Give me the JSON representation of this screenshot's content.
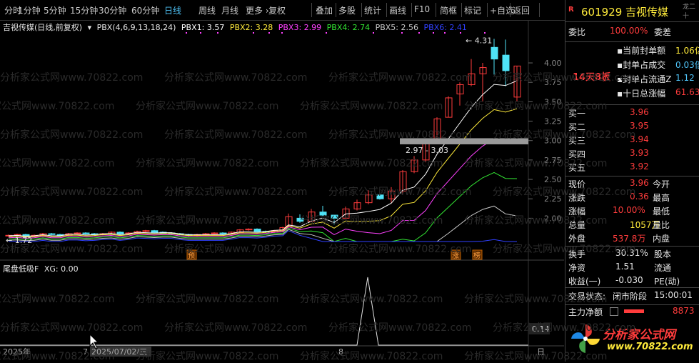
{
  "toolbar": {
    "items": [
      "分时",
      "1分钟",
      "5分钟",
      "15分钟",
      "30分钟",
      "60分钟",
      "日线",
      "周线",
      "月线",
      "更多 ›",
      "复权",
      "叠加",
      "多股",
      "统计",
      "画线",
      "F10",
      "简框",
      "标记",
      "+自选",
      "返回"
    ],
    "active_index": 6
  },
  "indicator_main": {
    "name": "吉视传媒(日线,前复权)",
    "formula": "PBX(4,6,9,13,18,24)",
    "pbx1": "PBX1: 3.57",
    "pbx2": "PBX2: 3.28",
    "pbx3": "PBX3: 2.99",
    "pbx4": "PBX4: 2.74",
    "pbx5": "PBX5: 2.56",
    "pbx6": "PBX6: 2.41"
  },
  "indicator_sub": {
    "name": "尾盘低吸F",
    "value": "XG: 0.00"
  },
  "chart_labels": {
    "high_mark": "4.31",
    "low_mark": "1.72",
    "range_mark": "2.97 - 3.03",
    "tag_yu": "预",
    "tag_zhang": "涨",
    "tag_bang": "榜",
    "sub_value": "0.14",
    "date_left": "2025年",
    "date_cursor": "2025/07/02/三",
    "date_7": "7",
    "date_8": "8",
    "date_right": "日"
  },
  "axis": {
    "ticks": [
      "4.00",
      "3.75",
      "3.50",
      "3.25",
      "3.00",
      "2.75",
      "2.50",
      "2.25",
      "2.00"
    ]
  },
  "chart_data": {
    "type": "candlestick",
    "y_ticks": [
      4.0,
      3.75,
      3.5,
      3.25,
      3.0,
      2.75,
      2.5,
      2.25,
      2.0
    ],
    "ylim": [
      1.7,
      4.35
    ]
  },
  "colors": {
    "up": "#ff3c3c",
    "down": "#4fe3f7",
    "pbx1": "#ffffff",
    "pbx2": "#ffeb3b",
    "pbx3": "#ff40ff",
    "pbx4": "#33e633",
    "pbx5": "#c8c8c8",
    "pbx6": "#3040ff"
  },
  "stock": {
    "code": "601929",
    "name": "吉视传媒",
    "corner": "龙二十"
  },
  "ratio": {
    "label": "委比",
    "value": "100.00%",
    "label2": "委差"
  },
  "board": {
    "streak": "14天8板",
    "items": [
      {
        "label": "当前封单额",
        "value": "1.06亿"
      },
      {
        "label": "封单占成交",
        "value": "0.03倍"
      },
      {
        "label": "封单占流通Z",
        "value": "1.12"
      },
      {
        "label": "十日总涨幅",
        "value": "61.63"
      }
    ]
  },
  "bids": [
    {
      "label": "买一",
      "price": "3.96"
    },
    {
      "label": "买二",
      "price": "3.95"
    },
    {
      "label": "买三",
      "price": "3.94"
    },
    {
      "label": "买四",
      "price": "3.93"
    },
    {
      "label": "买五",
      "price": "3.92"
    }
  ],
  "quote": [
    {
      "l1": "现价",
      "v1": "3.96",
      "l2": "今开"
    },
    {
      "l1": "涨跌",
      "v1": "0.36",
      "l2": "最高"
    },
    {
      "l1": "涨幅",
      "v1": "10.00%",
      "l2": "最低"
    },
    {
      "l1": "总量",
      "v1": "1057万",
      "l2": "量比"
    },
    {
      "l1": "外盘",
      "v1": "537.8万",
      "l2": "内盘"
    }
  ],
  "stats": [
    {
      "l1": "换手",
      "v1": "30.31%",
      "l2": "股本"
    },
    {
      "l1": "净资",
      "v1": "1.51",
      "l2": "流通"
    },
    {
      "l1": "收益(一)",
      "v1": "-0.030",
      "l2": "PE(动)"
    }
  ],
  "trade_status": {
    "label": "交易状态:",
    "value": "闭市阶段",
    "time": "15:00:01"
  },
  "main_flow": {
    "label": "主力净额",
    "value": "8873"
  },
  "logo": {
    "text": "分析家公式网",
    "url": "www.70822.com"
  },
  "watermark": "分析家公式网www.70822.com"
}
